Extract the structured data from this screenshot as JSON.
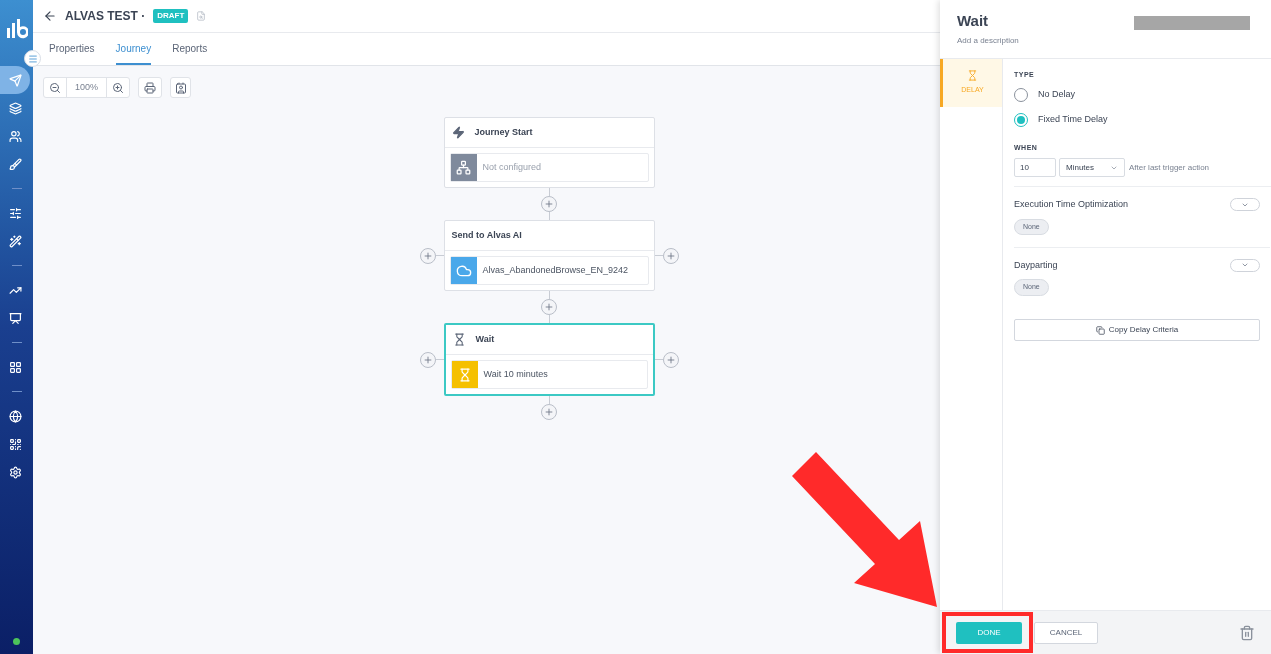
{
  "sidebar": {
    "items": [
      {
        "kind": "send",
        "selected": true
      },
      {
        "kind": "layers",
        "selected": false
      },
      {
        "kind": "users",
        "selected": false
      },
      {
        "kind": "brush",
        "selected": false
      },
      {
        "kind": "divider"
      },
      {
        "kind": "sliders",
        "selected": false
      },
      {
        "kind": "wand",
        "selected": false
      },
      {
        "kind": "divider"
      },
      {
        "kind": "chart",
        "selected": false
      },
      {
        "kind": "presentation",
        "selected": false
      },
      {
        "kind": "divider"
      },
      {
        "kind": "apps",
        "selected": false
      },
      {
        "kind": "divider"
      },
      {
        "kind": "globe",
        "selected": false
      },
      {
        "kind": "qr",
        "selected": false
      },
      {
        "kind": "settings",
        "selected": false
      }
    ],
    "status_online": true
  },
  "header": {
    "title": "ALVAS TEST ·",
    "badge": "DRAFT"
  },
  "tabs": [
    {
      "label": "Properties",
      "selected": false
    },
    {
      "label": "Journey",
      "selected": true
    },
    {
      "label": "Reports",
      "selected": false
    }
  ],
  "toolbar": {
    "zoom": "100%"
  },
  "canvas": {
    "nodes": [
      {
        "kind": "start",
        "title": "Journey Start",
        "detail": "Not configured",
        "selected": false,
        "side_buttons": false
      },
      {
        "kind": "send",
        "title": "Send to Alvas AI",
        "detail": "Alvas_AbandonedBrowse_EN_9242",
        "selected": false,
        "side_buttons": true
      },
      {
        "kind": "wait",
        "title": "Wait",
        "detail": "Wait 10 minutes",
        "selected": true,
        "side_buttons": true
      }
    ]
  },
  "panel": {
    "title": "Wait",
    "description": "Add a description",
    "side_tabs": [
      {
        "label": "DELAY",
        "selected": true
      }
    ],
    "type_label": "TYPE",
    "options": [
      {
        "label": "No Delay",
        "selected": false
      },
      {
        "label": "Fixed Time Delay",
        "selected": true
      }
    ],
    "when_label": "WHEN",
    "when_value": "10",
    "when_unit": "Minutes",
    "when_hint": "After last trigger action",
    "sections": [
      {
        "title": "Execution Time Optimization",
        "value": "None"
      },
      {
        "title": "Dayparting",
        "value": "None"
      }
    ],
    "copy_button": "Copy Delay Criteria",
    "done_button": "DONE",
    "cancel_button": "CANCEL"
  }
}
